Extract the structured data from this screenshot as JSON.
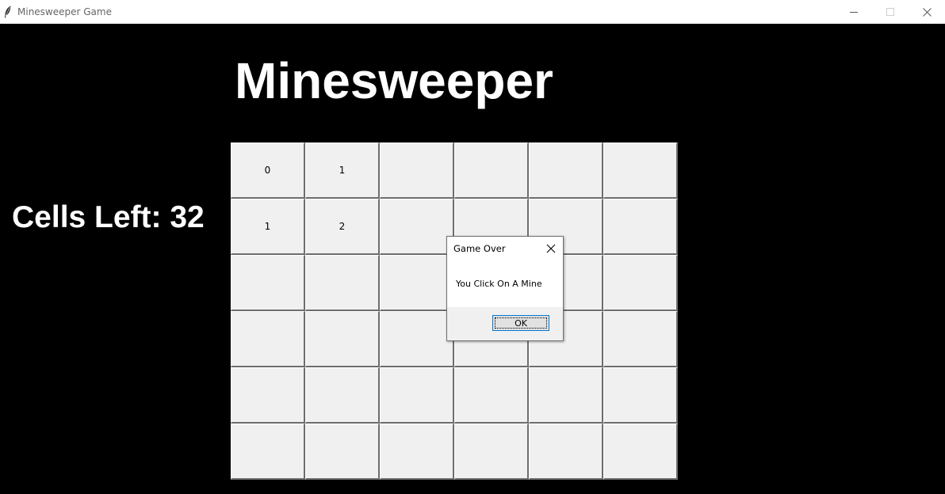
{
  "window": {
    "title": "Minesweeper Game",
    "icon": "feather-icon",
    "controls": [
      "minimize-icon",
      "maximize-icon",
      "close-icon"
    ]
  },
  "game": {
    "title": "Minesweeper",
    "cells_left": "Cells Left: 32",
    "board": [
      [
        "0",
        "1",
        "",
        "",
        "",
        ""
      ],
      [
        "1",
        "2",
        "",
        "",
        "",
        ""
      ],
      [
        "",
        "",
        "",
        "",
        "",
        ""
      ],
      [
        "",
        "",
        "",
        "",
        "",
        ""
      ],
      [
        "",
        "",
        "",
        "",
        "",
        ""
      ],
      [
        "",
        "",
        "",
        "",
        "",
        ""
      ]
    ]
  },
  "dialog": {
    "title": "Game Over",
    "message": "You Click On A Mine",
    "ok_label": "OK"
  },
  "colors": {
    "background": "#000000",
    "cell": "#f0f0f0",
    "accent": "#0078d7"
  }
}
